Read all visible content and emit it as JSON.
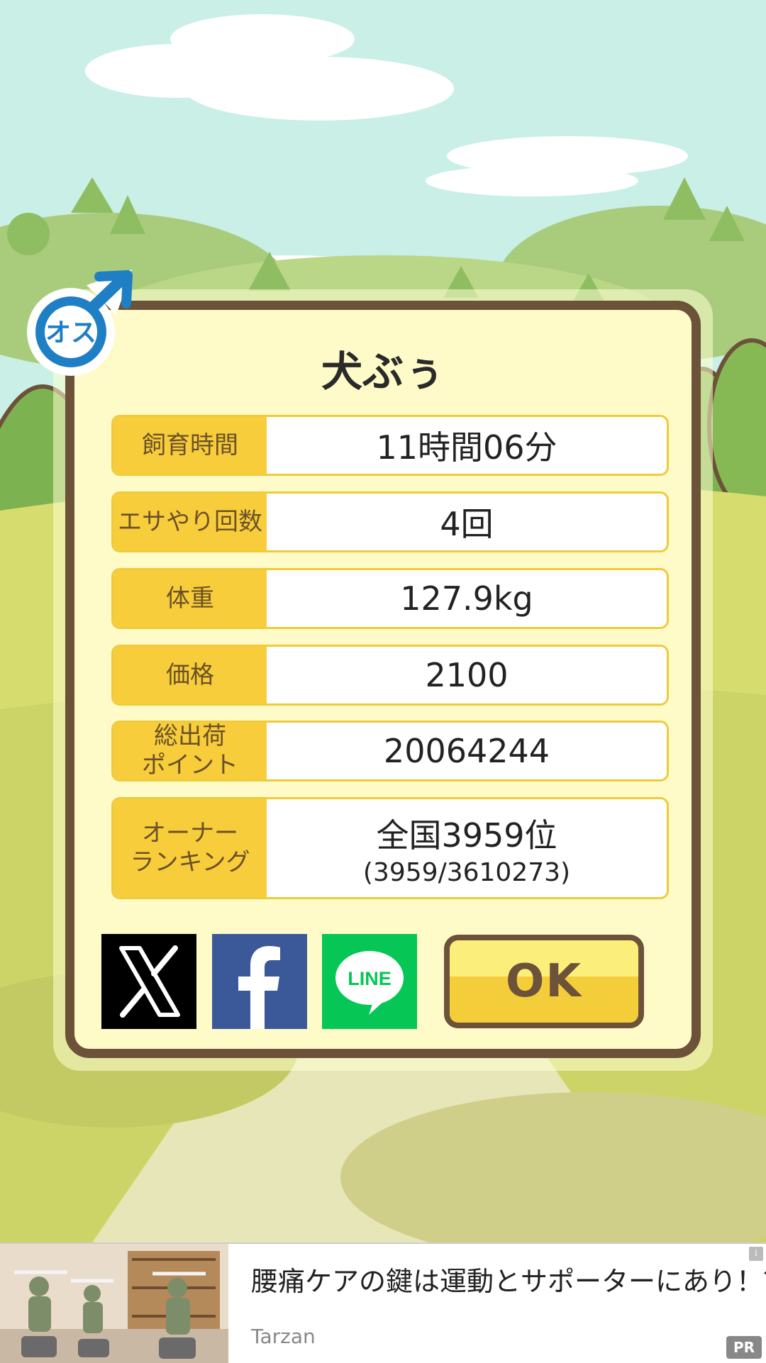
{
  "pet": {
    "name": "犬ぶぅ",
    "gender_badge_text": "オス"
  },
  "stats": [
    {
      "label": "飼育時間",
      "value": "11時間06分"
    },
    {
      "label": "エサやり回数",
      "value": "4回"
    },
    {
      "label": "体重",
      "value": "127.9kg"
    },
    {
      "label": "価格",
      "value": "2100"
    },
    {
      "label": "総出荷\nポイント",
      "value": "20064244"
    },
    {
      "label": "オーナー\nランキング",
      "value": "全国3959位",
      "sub_value": "(3959/3610273)"
    }
  ],
  "share": {
    "x_icon": "x-logo-icon",
    "facebook_icon": "facebook-logo-icon",
    "line_icon": "line-logo-icon",
    "line_text": "LINE"
  },
  "ok_label": "OK",
  "ad": {
    "title": "腰痛ケアの鍵は運動とサポーターにあり！？",
    "source": "Tarzan",
    "info_label": "i",
    "pr_label": "PR"
  },
  "colors": {
    "dialog_background": "#fffbc9",
    "dialog_border": "#6b5238",
    "label_background": "#f7cd3c",
    "x_brand": "#000000",
    "facebook_brand": "#3b5998",
    "line_brand": "#06c755"
  }
}
